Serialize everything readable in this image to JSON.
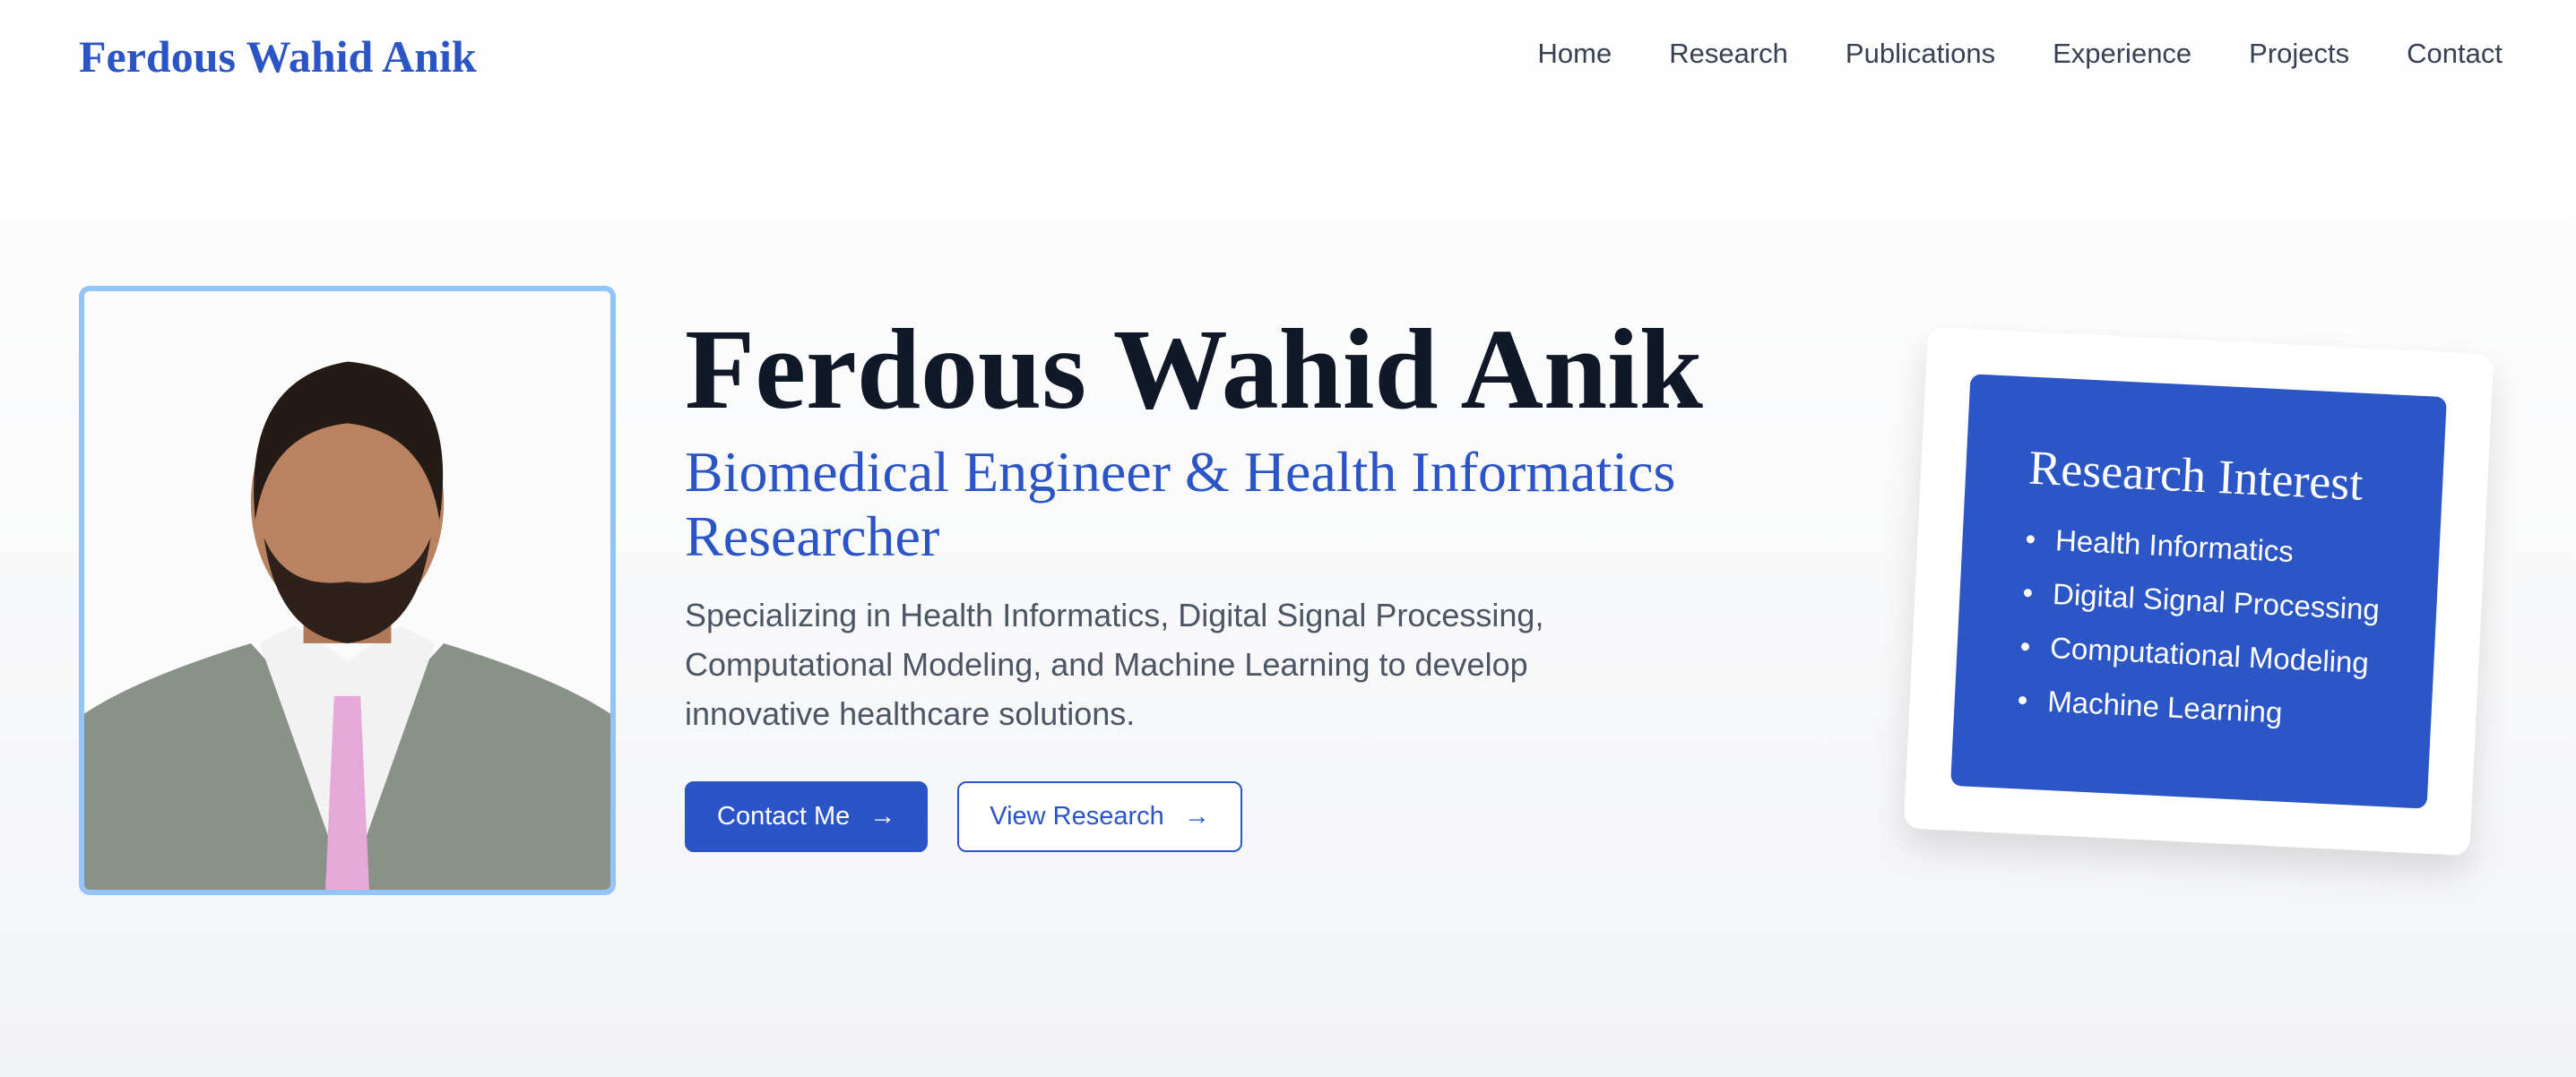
{
  "header": {
    "logo": "Ferdous Wahid Anik",
    "nav": [
      "Home",
      "Research",
      "Publications",
      "Experience",
      "Projects",
      "Contact"
    ]
  },
  "hero": {
    "name": "Ferdous Wahid Anik",
    "title": "Biomedical Engineer & Health Informatics Researcher",
    "description": "Specializing in Health Informatics, Digital Signal Processing, Computational Modeling, and Machine Learning to develop innovative healthcare solutions.",
    "contact_button": "Contact Me",
    "research_button": "View Research",
    "arrow_icon": "arrow-right-icon"
  },
  "card": {
    "title": "Research Interest",
    "items": [
      "Health Informatics",
      "Digital Signal Processing",
      "Computational Modeling",
      "Machine Learning"
    ]
  },
  "colors": {
    "accent": "#2b55c6",
    "photo_border": "#93c5fd"
  }
}
